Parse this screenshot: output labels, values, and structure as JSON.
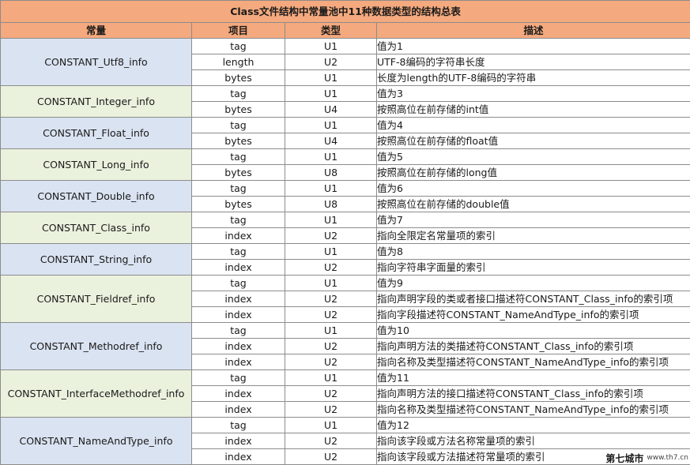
{
  "title": "Class文件结构中常量池中11种数据类型的结构总表",
  "headers": [
    "常量",
    "项目",
    "类型",
    "描述"
  ],
  "groups": [
    {
      "name": "CONSTANT_Utf8_info",
      "rows": [
        {
          "item": "tag",
          "type": "U1",
          "desc": "值为1"
        },
        {
          "item": "length",
          "type": "U2",
          "desc": "UTF-8编码的字符串长度"
        },
        {
          "item": "bytes",
          "type": "U1",
          "desc": "长度为length的UTF-8编码的字符串"
        }
      ]
    },
    {
      "name": "CONSTANT_Integer_info",
      "rows": [
        {
          "item": "tag",
          "type": "U1",
          "desc": "值为3"
        },
        {
          "item": "bytes",
          "type": "U4",
          "desc": "按照高位在前存储的int值"
        }
      ]
    },
    {
      "name": "CONSTANT_Float_info",
      "rows": [
        {
          "item": "tag",
          "type": "U1",
          "desc": "值为4"
        },
        {
          "item": "bytes",
          "type": "U4",
          "desc": "按照高位在前存储的float值"
        }
      ]
    },
    {
      "name": "CONSTANT_Long_info",
      "rows": [
        {
          "item": "tag",
          "type": "U1",
          "desc": "值为5"
        },
        {
          "item": "bytes",
          "type": "U8",
          "desc": "按照高位在前存储的long值"
        }
      ]
    },
    {
      "name": "CONSTANT_Double_info",
      "rows": [
        {
          "item": "tag",
          "type": "U1",
          "desc": "值为6"
        },
        {
          "item": "bytes",
          "type": "U8",
          "desc": "按照高位在前存储的double值"
        }
      ]
    },
    {
      "name": "CONSTANT_Class_info",
      "rows": [
        {
          "item": "tag",
          "type": "U1",
          "desc": "值为7"
        },
        {
          "item": "index",
          "type": "U2",
          "desc": "指向全限定名常量项的索引"
        }
      ]
    },
    {
      "name": "CONSTANT_String_info",
      "rows": [
        {
          "item": "tag",
          "type": "U1",
          "desc": "值为8"
        },
        {
          "item": "index",
          "type": "U2",
          "desc": "指向字符串字面量的索引"
        }
      ]
    },
    {
      "name": "CONSTANT_Fieldref_info",
      "rows": [
        {
          "item": "tag",
          "type": "U1",
          "desc": "值为9"
        },
        {
          "item": "index",
          "type": "U2",
          "desc": "指向声明字段的类或者接口描述符CONSTANT_Class_info的索引项"
        },
        {
          "item": "index",
          "type": "U2",
          "desc": "指向字段描述符CONSTANT_NameAndType_info的索引项"
        }
      ]
    },
    {
      "name": "CONSTANT_Methodref_info",
      "rows": [
        {
          "item": "tag",
          "type": "U1",
          "desc": "值为10"
        },
        {
          "item": "index",
          "type": "U2",
          "desc": "指向声明方法的类描述符CONSTANT_Class_info的索引项"
        },
        {
          "item": "index",
          "type": "U2",
          "desc": "指向名称及类型描述符CONSTANT_NameAndType_info的索引项"
        }
      ]
    },
    {
      "name": "CONSTANT_InterfaceMethodref_info",
      "rows": [
        {
          "item": "tag",
          "type": "U1",
          "desc": "值为11"
        },
        {
          "item": "index",
          "type": "U2",
          "desc": "指向声明方法的接口描述符CONSTANT_Class_info的索引项"
        },
        {
          "item": "index",
          "type": "U2",
          "desc": "指向名称及类型描述符CONSTANT_NameAndType_info的索引项"
        }
      ]
    },
    {
      "name": "CONSTANT_NameAndType_info",
      "rows": [
        {
          "item": "tag",
          "type": "U1",
          "desc": "值为12"
        },
        {
          "item": "index",
          "type": "U2",
          "desc": "指向该字段或方法名称常量项的索引"
        },
        {
          "item": "index",
          "type": "U2",
          "desc": "指向该字段或方法描述符常量项的索引"
        }
      ]
    }
  ],
  "watermark": {
    "logo": "第七城市",
    "url": "www.th7.cn"
  },
  "colors": {
    "header": "#f4a97e",
    "group_blue": "#dae3f1",
    "group_green": "#eaf1dd",
    "border": "#8c8c8c"
  }
}
